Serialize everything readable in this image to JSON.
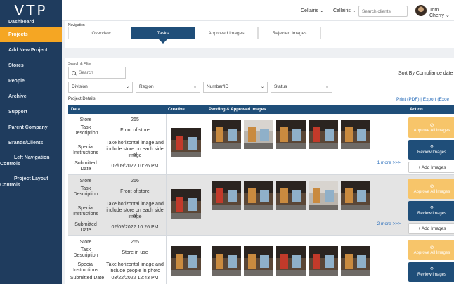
{
  "logo": "VTP",
  "sidebar": {
    "items": [
      {
        "label": "Dashboard"
      },
      {
        "label": "Projects",
        "active": true
      },
      {
        "label": "Add New Project"
      },
      {
        "label": "Stores"
      },
      {
        "label": "People"
      },
      {
        "label": "Archive"
      },
      {
        "label": "Support"
      },
      {
        "label": "Parent Company"
      },
      {
        "label": "Brands/Clients"
      },
      {
        "label_1": "Left Navigation",
        "label_2": "Controls"
      },
      {
        "label_1": "Project Layout",
        "label_2": "Controls"
      }
    ]
  },
  "topbar": {
    "client_select_1": "Cellairis ⌄",
    "client_select_2": "Cellairis ⌄",
    "search_placeholder": "Search clients",
    "user_name": "Tom Cherry ⌄"
  },
  "navigation": {
    "label": "Navigation",
    "tabs": [
      {
        "label": "Overview"
      },
      {
        "label": "Tasks",
        "active": true
      },
      {
        "label": "Approved Images"
      },
      {
        "label": "Rejected Images"
      }
    ]
  },
  "filters": {
    "label": "Search & Filter",
    "search_placeholder": "Search",
    "sort_label": "Sort By Compliance date ⌄",
    "dropdowns": [
      "Division",
      "Region",
      "Number/ID",
      "Status"
    ],
    "project_details": "Project Details",
    "print_export": "Print (PDF) | Export (Exce"
  },
  "table": {
    "headers": [
      "Data",
      "Creative",
      "Pending & Approved Images",
      "Action"
    ],
    "field_labels": {
      "store": "Store",
      "task_1": "Task",
      "task_2": "Description",
      "special_1": "Special",
      "special_2": "Instructions",
      "submitted_1": "Submitted",
      "submitted_2": "Date",
      "submitted_date_inline": "Submitted Date"
    },
    "rows": [
      {
        "store": "265",
        "task": "Front of store",
        "instructions_1": "Take horizontal image and",
        "instructions_2": "include store on each side of",
        "instructions_3": "image",
        "submitted": "02/09/2022 10:26 PM",
        "more": "1 more >>>"
      },
      {
        "store": "266",
        "task": "Front of store",
        "instructions_1": "Take horizontal image and",
        "instructions_2": "include store on each side of",
        "instructions_3": "image",
        "submitted": "02/09/2022 10:26 PM",
        "more": "2 more >>>"
      },
      {
        "store": "265",
        "task": "Store in use",
        "instructions_1": "Take horizontal image and",
        "instructions_2": "include people in photo",
        "submitted": "03/22/2022 12:43 PM"
      }
    ],
    "actions": {
      "approve": "Approve All Images",
      "review": "Review Images",
      "add": "+ Add Images"
    }
  }
}
